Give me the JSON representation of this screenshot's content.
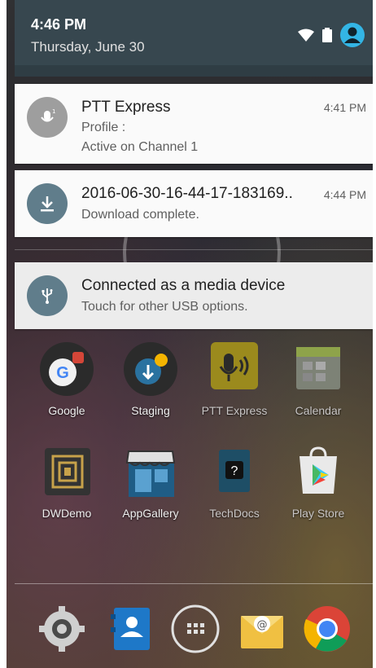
{
  "status_bar": {
    "time": "4:46 PM",
    "date": "Thursday, June 30",
    "icons": [
      "wifi-icon",
      "battery-icon",
      "user-avatar-icon"
    ],
    "accent_color": "#33b5e5"
  },
  "notifications": [
    {
      "app": "PTT Express",
      "line1": "Profile :",
      "line2": "Active on Channel 1",
      "time": "4:41 PM",
      "icon": "microphone-icon",
      "icon_color": "#9e9e9e"
    },
    {
      "title": "2016-06-30-16-44-17-183169..",
      "text": "Download complete.",
      "time": "4:44 PM",
      "icon": "download-icon",
      "icon_color": "#607d8b"
    },
    {
      "title": "Connected as a media device",
      "text": "Touch for other USB options.",
      "icon": "usb-icon",
      "icon_color": "#607d8b"
    }
  ],
  "home_apps": [
    {
      "label": "Google",
      "icon": "google-folder-icon"
    },
    {
      "label": "Staging",
      "icon": "staging-folder-icon"
    },
    {
      "label": "PTT Express",
      "icon": "ptt-express-icon"
    },
    {
      "label": "Calendar",
      "icon": "calendar-icon"
    },
    {
      "label": "DWDemo",
      "icon": "dwdemo-icon"
    },
    {
      "label": "AppGallery",
      "icon": "appgallery-icon"
    },
    {
      "label": "TechDocs",
      "icon": "techdocs-icon"
    },
    {
      "label": "Play Store",
      "icon": "play-store-icon"
    }
  ],
  "dock": [
    "settings-icon",
    "contacts-icon",
    "all-apps-icon",
    "email-icon",
    "chrome-icon"
  ]
}
